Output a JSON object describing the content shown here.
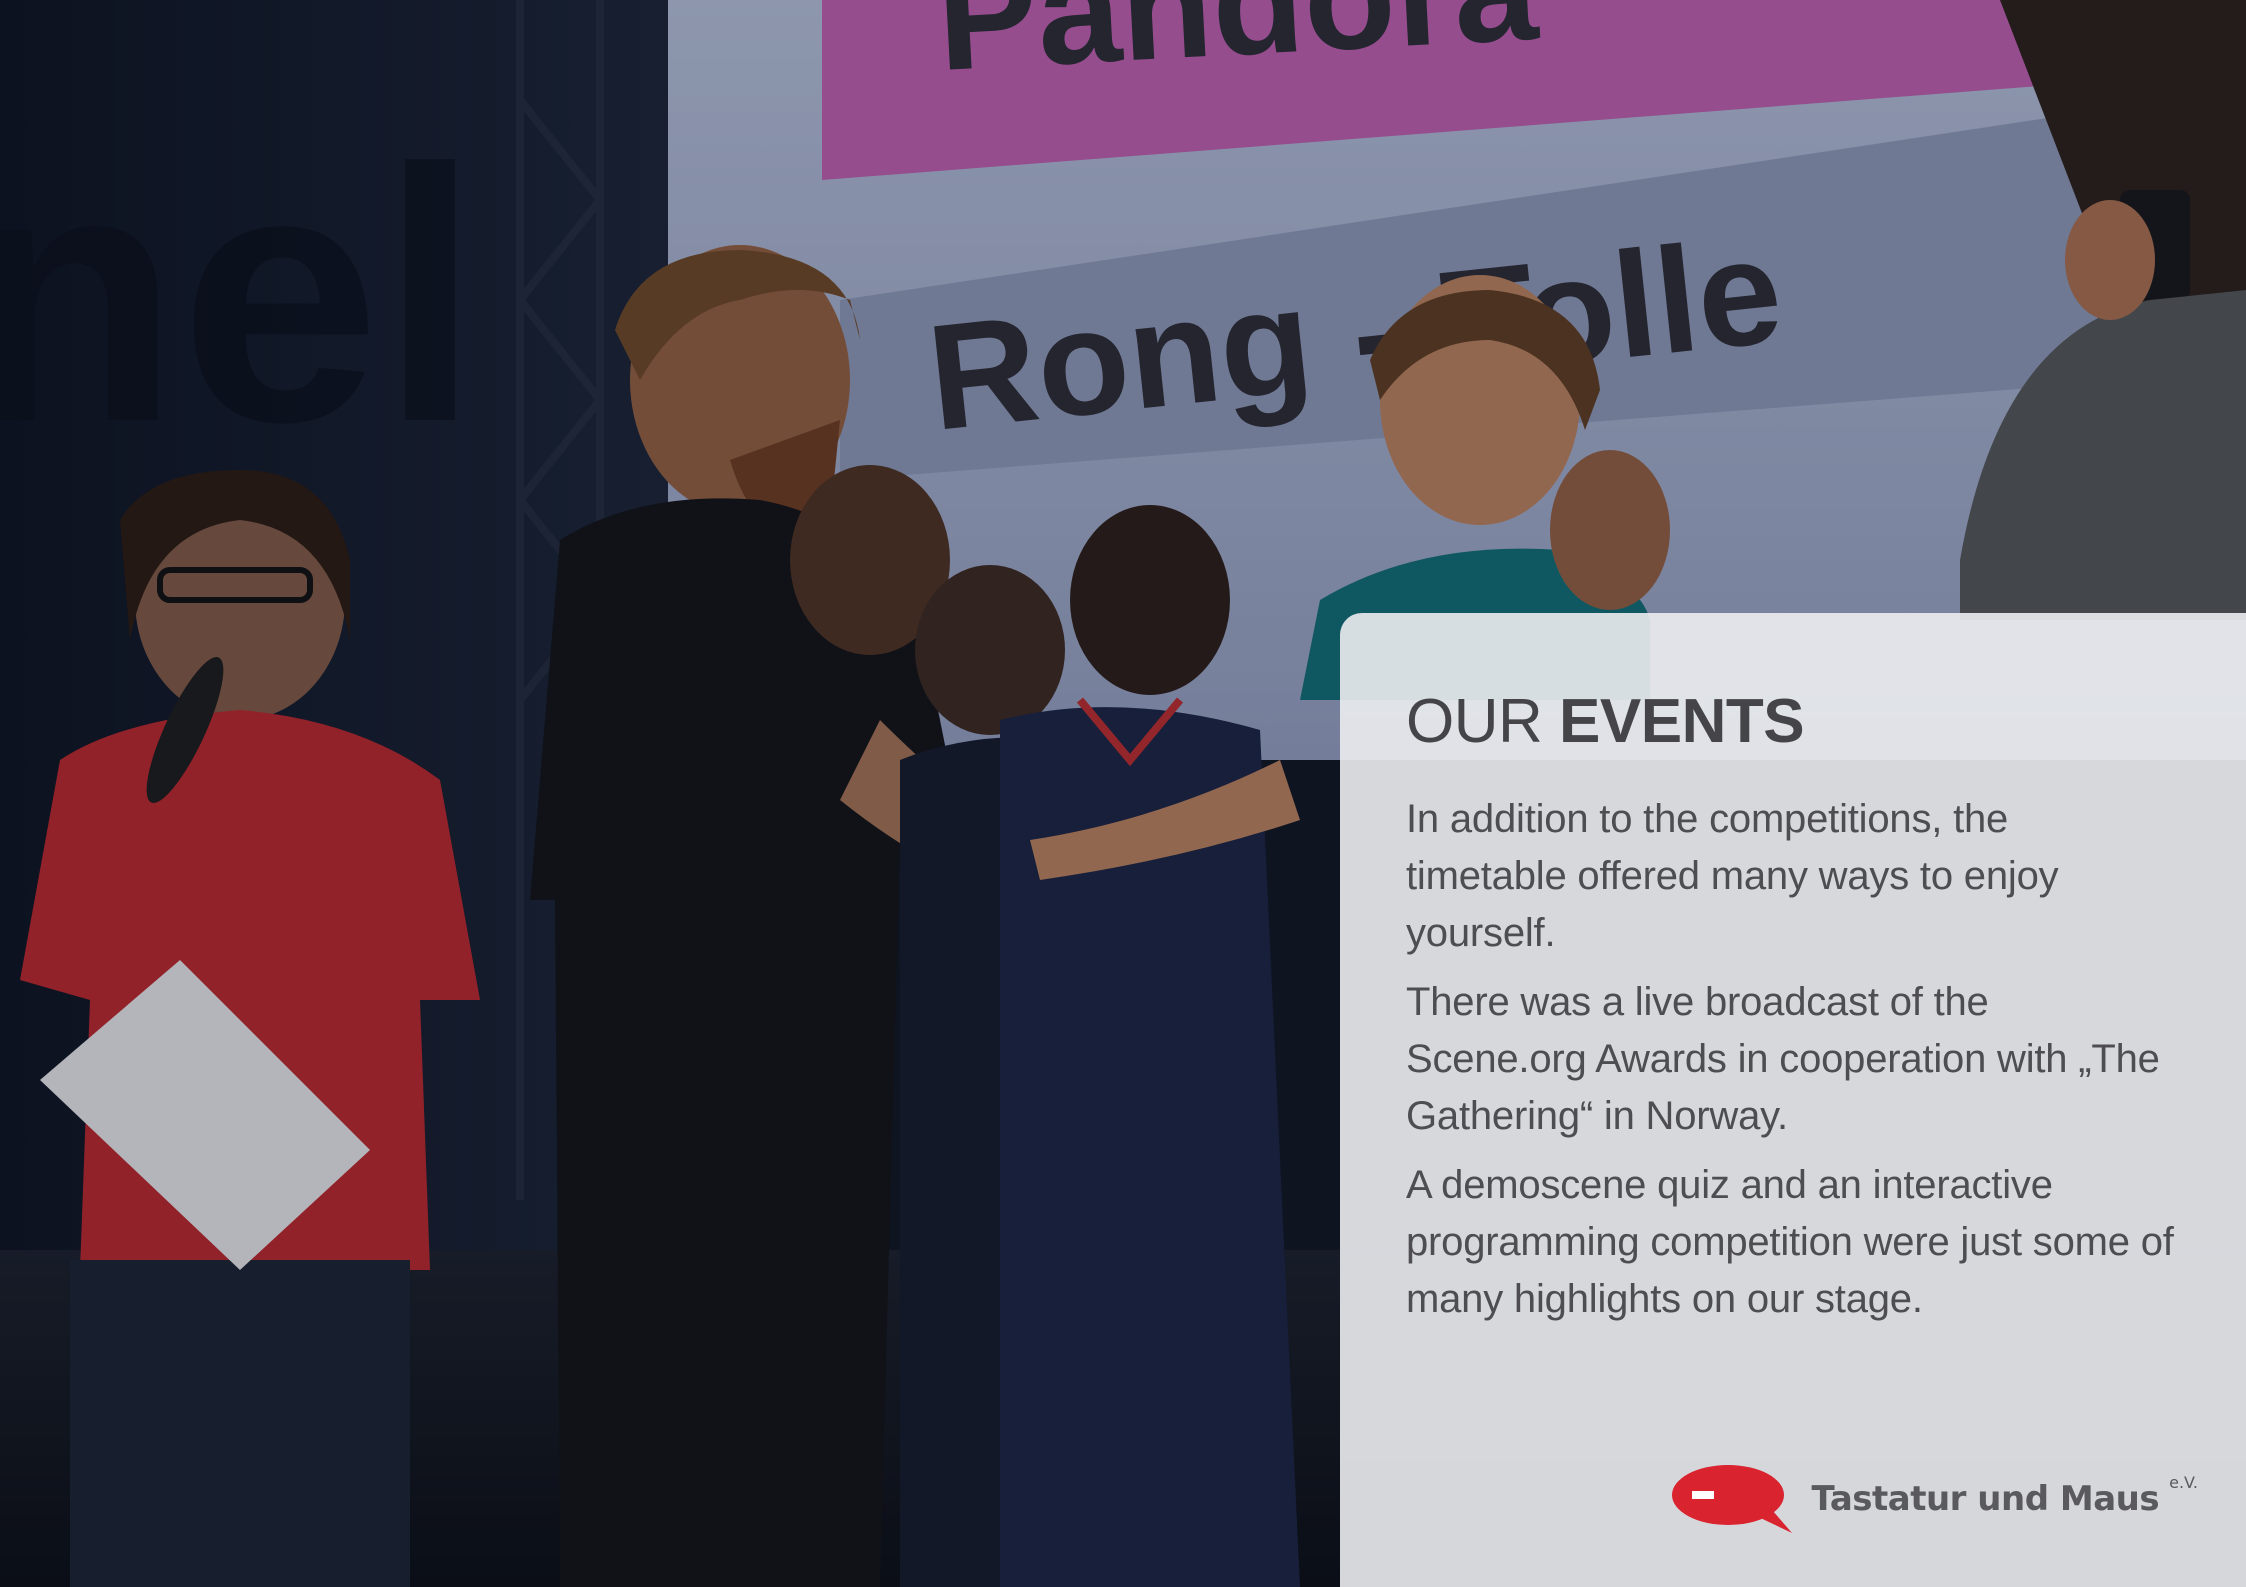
{
  "background_photo": {
    "screen_banner_top": "Pandora",
    "screen_banner_bottom": "Rong - Tolle"
  },
  "card": {
    "heading_light": "OUR",
    "heading_bold": "EVENTS",
    "paragraphs": [
      "In addition to the competitions, the timetable offered many ways to enjoy yourself.",
      "There was a live broadcast of the Scene.org Awards in cooperation with „The Gathering“ in Norway.",
      "A demoscene quiz and an interactive programming competition were just some of many highlights on our stage."
    ]
  },
  "logo": {
    "name": "Tastatur und Maus",
    "suffix": "e.V.",
    "icon": "speech-bubble-icon",
    "color": "#d9232e"
  }
}
